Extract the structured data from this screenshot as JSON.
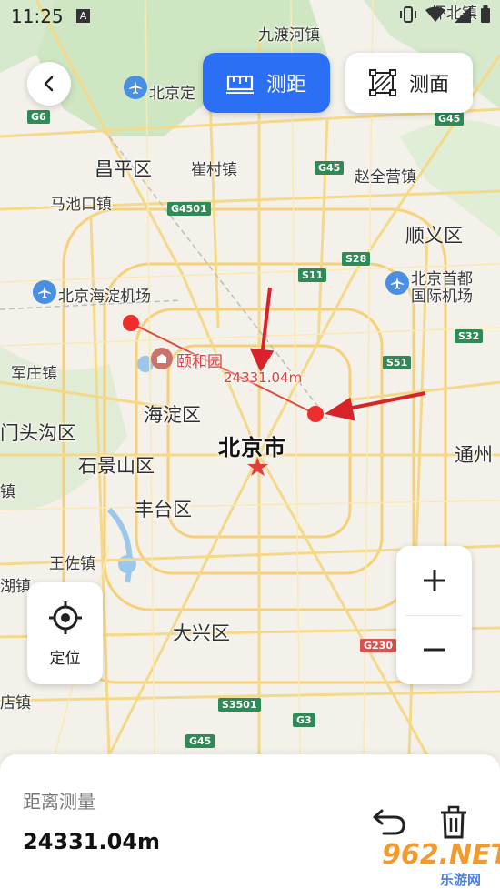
{
  "status_bar": {
    "time": "11:25",
    "badge": "A"
  },
  "toolbar": {
    "tabs": [
      {
        "label": "测距",
        "active": true
      },
      {
        "label": "测面",
        "active": false
      }
    ]
  },
  "map": {
    "labels": {
      "jiudu": "九渡河镇",
      "beijing_fragment": "北京定",
      "huaibei": "怀北镇",
      "changping": "昌平区",
      "cuicun": "崔村镇",
      "zhaoquanying": "赵全营镇",
      "machikou": "马池口镇",
      "shunyi": "顺义区",
      "haidian_airport": "北京海淀机场",
      "capital_airport_1": "北京首都",
      "capital_airport_2": "国际机场",
      "yiheyuan": "颐和园",
      "wangzhuang": "军庄镇",
      "haidian": "海淀区",
      "mentougou": "门头沟区",
      "beijing_city": "北京市",
      "tongzhou": "通州",
      "shijingshan": "石景山区",
      "zhen_left": "镇",
      "fengtai": "丰台区",
      "wangzuo": "王佐镇",
      "hu_left": "湖镇",
      "daxing": "大兴区",
      "dian": "店镇"
    },
    "shields": {
      "g6": "G6",
      "g45_top": "G45",
      "g45_mid": "G45",
      "g4501": "G4501",
      "s11": "S11",
      "s28": "S28",
      "s32": "S32",
      "s51": "S51",
      "g230": "G230",
      "s3501": "S3501",
      "g3": "G3",
      "g45_bottom": "G45"
    },
    "measure": {
      "distance_label": "24331.04m",
      "line_color": "#e04b3d",
      "point_color": "#ee2d2d"
    },
    "annotation_color": "#d8232a"
  },
  "controls": {
    "locate_label": "定位"
  },
  "panel": {
    "title": "距离测量",
    "distance_value": "24331.04m"
  },
  "watermark": {
    "number": "962.NET",
    "text": "乐游网"
  },
  "colors": {
    "accent": "#2b6ff6"
  }
}
